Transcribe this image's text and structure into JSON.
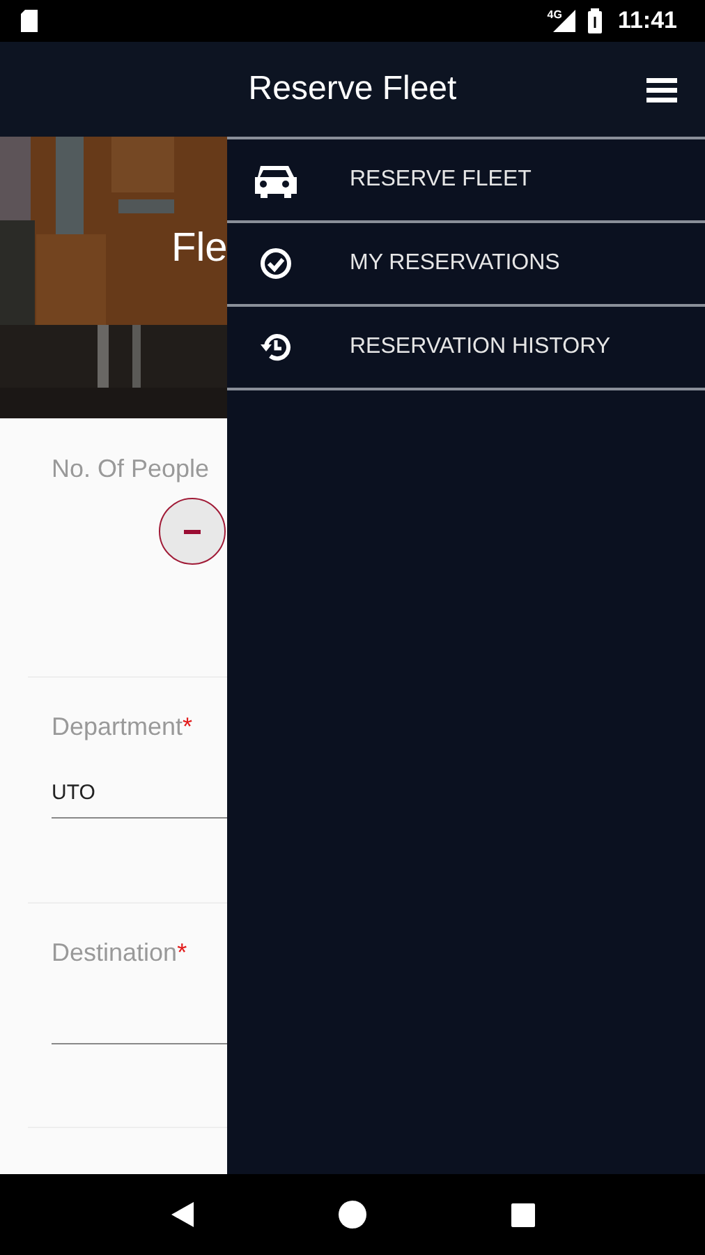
{
  "status_bar": {
    "network": "4G",
    "time": "11:41"
  },
  "app_bar": {
    "title": "Reserve Fleet"
  },
  "hero": {
    "title": "Fle"
  },
  "form": {
    "fields": [
      {
        "kind": "stepper",
        "label": "No. Of People"
      },
      {
        "kind": "text",
        "label": "Department",
        "required_mark": "*",
        "value": "UTO"
      },
      {
        "kind": "text",
        "label": "Destination",
        "required_mark": "*"
      }
    ]
  },
  "drawer": {
    "items": [
      {
        "kind": "car",
        "label": "RESERVE FLEET"
      },
      {
        "kind": "check",
        "label": "MY RESERVATIONS"
      },
      {
        "kind": "history",
        "label": "RESERVATION HISTORY"
      }
    ]
  }
}
